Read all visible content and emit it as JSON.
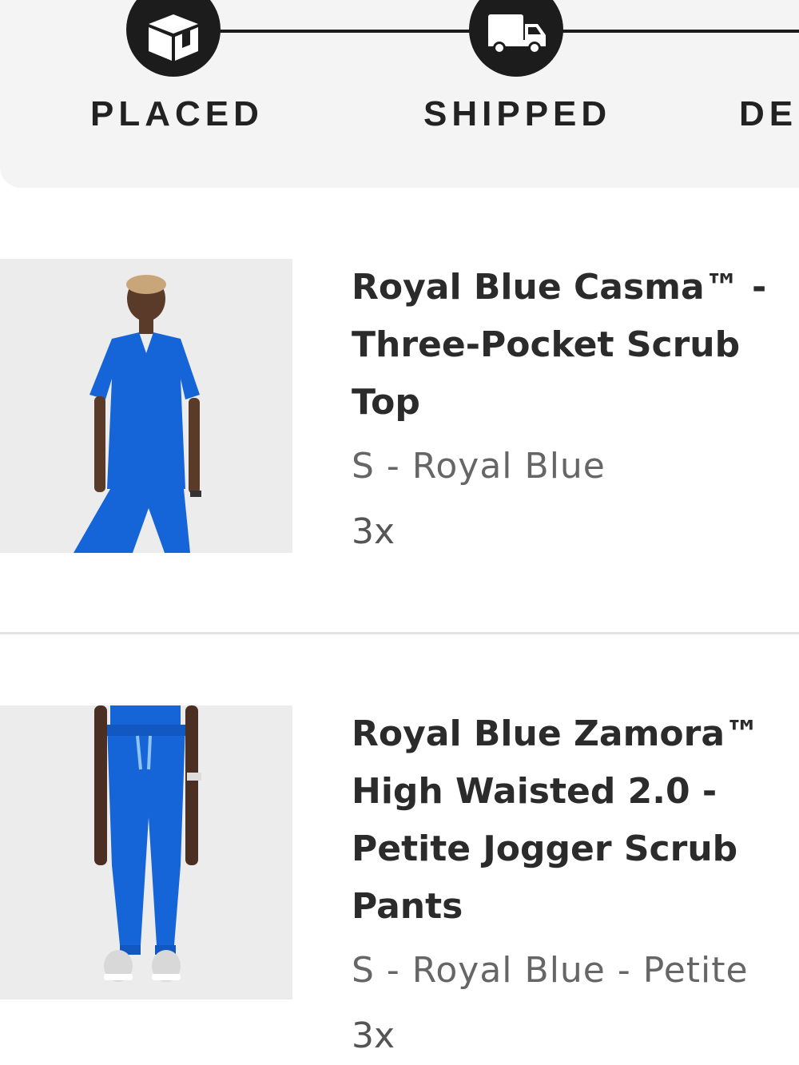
{
  "tracker": {
    "steps": [
      {
        "label": "PLACED",
        "icon": "box-icon"
      },
      {
        "label": "SHIPPED",
        "icon": "truck-icon"
      },
      {
        "label": "DE",
        "icon": ""
      }
    ]
  },
  "items": [
    {
      "title_lines": [
        "Royal Blue Casma™ -",
        "Three-Pocket Scrub",
        "Top"
      ],
      "variant": "S - Royal Blue",
      "quantity": "3x",
      "image": "product-photo-scrub-top",
      "color": "#1565d8"
    },
    {
      "title_lines": [
        "Royal Blue Zamora™",
        "High Waisted 2.0 -",
        "Petite Jogger Scrub",
        "Pants"
      ],
      "variant": "S - Royal Blue - Petite",
      "quantity": "3x",
      "image": "product-photo-jogger-pants",
      "color": "#1565d8"
    }
  ]
}
